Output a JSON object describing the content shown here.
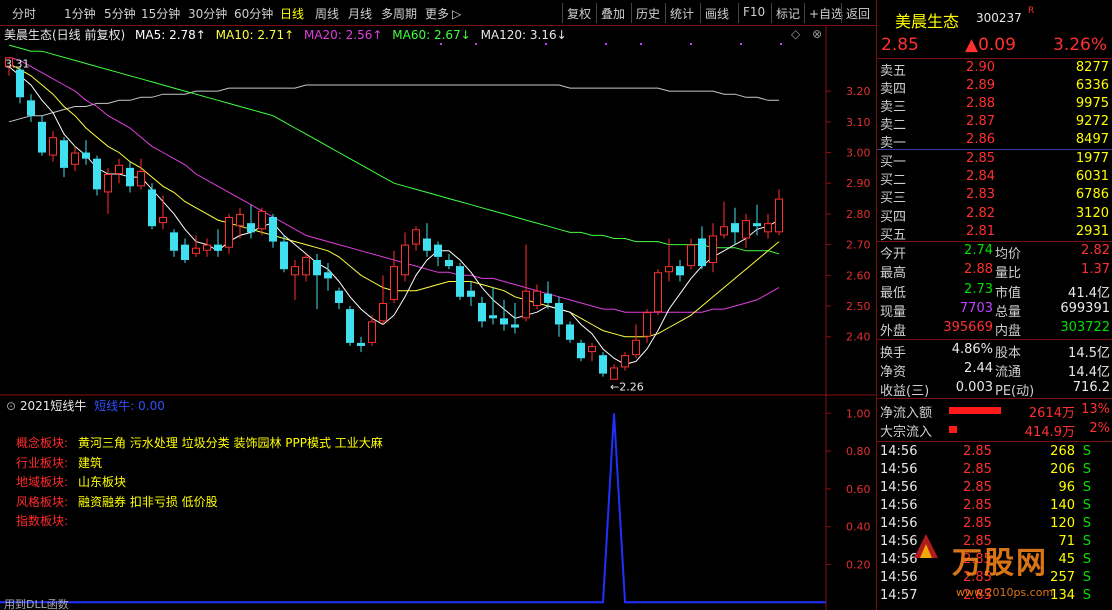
{
  "toolbar": {
    "periods": [
      "分时",
      "1分钟",
      "5分钟",
      "15分钟",
      "30分钟",
      "60分钟",
      "日线",
      "周线",
      "月线",
      "多周期",
      "更多"
    ],
    "active_period": "日线",
    "more_arrow": "▷",
    "actions": [
      "复权",
      "叠加",
      "历史",
      "统计",
      "画线",
      "F10",
      "标记",
      "+自选",
      "返回"
    ]
  },
  "chart": {
    "title": "美晨生态(日线 前复权)",
    "ma5": "MA5: 2.78↑",
    "ma10": "MA10: 2.71↑",
    "ma20": "MA20: 2.56↑",
    "ma60": "MA60: 2.67↓",
    "ma120": "MA120: 3.16↓",
    "high_label": "3.31",
    "low_label": "←2.26",
    "y_ticks": [
      "3.20",
      "3.10",
      "3.00",
      "2.90",
      "2.80",
      "2.70",
      "2.60",
      "2.50",
      "2.40"
    ],
    "colors": {
      "up": "#ff3030",
      "down": "#40e0f0",
      "ma5": "#ffffff",
      "ma10": "#ffff40",
      "ma20": "#e040e0",
      "ma60": "#40ff40",
      "ma120": "#c8c8c8"
    }
  },
  "chart_data": {
    "type": "candlestick",
    "title": "美晨生态(日线 前复权)",
    "y_ticks": [
      3.2,
      3.1,
      3.0,
      2.9,
      2.8,
      2.7,
      2.6,
      2.5,
      2.4
    ],
    "ylim": [
      2.22,
      3.36
    ],
    "candles": [
      {
        "o": 3.28,
        "c": 3.31,
        "h": 3.31,
        "l": 3.25
      },
      {
        "o": 3.27,
        "c": 3.18,
        "h": 3.28,
        "l": 3.16
      },
      {
        "o": 3.17,
        "c": 3.12,
        "h": 3.19,
        "l": 3.1
      },
      {
        "o": 3.1,
        "c": 3.0,
        "h": 3.12,
        "l": 2.99
      },
      {
        "o": 2.99,
        "c": 3.05,
        "h": 3.07,
        "l": 2.97
      },
      {
        "o": 3.04,
        "c": 2.95,
        "h": 3.05,
        "l": 2.92
      },
      {
        "o": 2.96,
        "c": 3.0,
        "h": 3.02,
        "l": 2.94
      },
      {
        "o": 3.0,
        "c": 2.98,
        "h": 3.04,
        "l": 2.96
      },
      {
        "o": 2.98,
        "c": 2.88,
        "h": 2.99,
        "l": 2.86
      },
      {
        "o": 2.87,
        "c": 2.93,
        "h": 2.95,
        "l": 2.8
      },
      {
        "o": 2.93,
        "c": 2.96,
        "h": 2.98,
        "l": 2.9
      },
      {
        "o": 2.95,
        "c": 2.89,
        "h": 2.97,
        "l": 2.87
      },
      {
        "o": 2.89,
        "c": 2.94,
        "h": 2.98,
        "l": 2.88
      },
      {
        "o": 2.88,
        "c": 2.76,
        "h": 2.9,
        "l": 2.75
      },
      {
        "o": 2.77,
        "c": 2.79,
        "h": 2.86,
        "l": 2.75
      },
      {
        "o": 2.74,
        "c": 2.68,
        "h": 2.75,
        "l": 2.66
      },
      {
        "o": 2.7,
        "c": 2.65,
        "h": 2.72,
        "l": 2.64
      },
      {
        "o": 2.67,
        "c": 2.69,
        "h": 2.73,
        "l": 2.66
      },
      {
        "o": 2.68,
        "c": 2.7,
        "h": 2.72,
        "l": 2.66
      },
      {
        "o": 2.7,
        "c": 2.68,
        "h": 2.75,
        "l": 2.66
      },
      {
        "o": 2.69,
        "c": 2.79,
        "h": 2.8,
        "l": 2.67
      },
      {
        "o": 2.76,
        "c": 2.8,
        "h": 2.82,
        "l": 2.72
      },
      {
        "o": 2.77,
        "c": 2.74,
        "h": 2.83,
        "l": 2.72
      },
      {
        "o": 2.75,
        "c": 2.81,
        "h": 2.82,
        "l": 2.73
      },
      {
        "o": 2.79,
        "c": 2.71,
        "h": 2.8,
        "l": 2.69
      },
      {
        "o": 2.71,
        "c": 2.62,
        "h": 2.73,
        "l": 2.61
      },
      {
        "o": 2.6,
        "c": 2.63,
        "h": 2.65,
        "l": 2.52
      },
      {
        "o": 2.6,
        "c": 2.66,
        "h": 2.67,
        "l": 2.58
      },
      {
        "o": 2.65,
        "c": 2.6,
        "h": 2.67,
        "l": 2.49
      },
      {
        "o": 2.61,
        "c": 2.59,
        "h": 2.64,
        "l": 2.55
      },
      {
        "o": 2.55,
        "c": 2.51,
        "h": 2.56,
        "l": 2.49
      },
      {
        "o": 2.49,
        "c": 2.38,
        "h": 2.5,
        "l": 2.37
      },
      {
        "o": 2.38,
        "c": 2.37,
        "h": 2.4,
        "l": 2.35
      },
      {
        "o": 2.38,
        "c": 2.45,
        "h": 2.47,
        "l": 2.37
      },
      {
        "o": 2.45,
        "c": 2.51,
        "h": 2.6,
        "l": 2.44
      },
      {
        "o": 2.52,
        "c": 2.63,
        "h": 2.68,
        "l": 2.51
      },
      {
        "o": 2.6,
        "c": 2.7,
        "h": 2.74,
        "l": 2.58
      },
      {
        "o": 2.7,
        "c": 2.75,
        "h": 2.76,
        "l": 2.68
      },
      {
        "o": 2.72,
        "c": 2.68,
        "h": 2.77,
        "l": 2.66
      },
      {
        "o": 2.7,
        "c": 2.66,
        "h": 2.71,
        "l": 2.63
      },
      {
        "o": 2.65,
        "c": 2.63,
        "h": 2.67,
        "l": 2.62
      },
      {
        "o": 2.63,
        "c": 2.53,
        "h": 2.64,
        "l": 2.52
      },
      {
        "o": 2.55,
        "c": 2.53,
        "h": 2.58,
        "l": 2.5
      },
      {
        "o": 2.51,
        "c": 2.45,
        "h": 2.53,
        "l": 2.43
      },
      {
        "o": 2.47,
        "c": 2.46,
        "h": 2.56,
        "l": 2.44
      },
      {
        "o": 2.46,
        "c": 2.44,
        "h": 2.52,
        "l": 2.42
      },
      {
        "o": 2.44,
        "c": 2.43,
        "h": 2.51,
        "l": 2.41
      },
      {
        "o": 2.46,
        "c": 2.55,
        "h": 2.7,
        "l": 2.45
      },
      {
        "o": 2.5,
        "c": 2.55,
        "h": 2.57,
        "l": 2.49
      },
      {
        "o": 2.54,
        "c": 2.51,
        "h": 2.58,
        "l": 2.49
      },
      {
        "o": 2.51,
        "c": 2.44,
        "h": 2.53,
        "l": 2.4
      },
      {
        "o": 2.44,
        "c": 2.39,
        "h": 2.45,
        "l": 2.38
      },
      {
        "o": 2.38,
        "c": 2.33,
        "h": 2.39,
        "l": 2.32
      },
      {
        "o": 2.35,
        "c": 2.37,
        "h": 2.38,
        "l": 2.32
      },
      {
        "o": 2.34,
        "c": 2.28,
        "h": 2.35,
        "l": 2.27
      },
      {
        "o": 2.26,
        "c": 2.3,
        "h": 2.31,
        "l": 2.26
      },
      {
        "o": 2.3,
        "c": 2.34,
        "h": 2.35,
        "l": 2.29
      },
      {
        "o": 2.34,
        "c": 2.39,
        "h": 2.44,
        "l": 2.33
      },
      {
        "o": 2.4,
        "c": 2.48,
        "h": 2.49,
        "l": 2.38
      },
      {
        "o": 2.48,
        "c": 2.61,
        "h": 2.62,
        "l": 2.47
      },
      {
        "o": 2.61,
        "c": 2.63,
        "h": 2.72,
        "l": 2.58
      },
      {
        "o": 2.63,
        "c": 2.6,
        "h": 2.65,
        "l": 2.58
      },
      {
        "o": 2.63,
        "c": 2.7,
        "h": 2.72,
        "l": 2.62
      },
      {
        "o": 2.72,
        "c": 2.63,
        "h": 2.76,
        "l": 2.62
      },
      {
        "o": 2.64,
        "c": 2.73,
        "h": 2.77,
        "l": 2.61
      },
      {
        "o": 2.73,
        "c": 2.76,
        "h": 2.84,
        "l": 2.72
      },
      {
        "o": 2.77,
        "c": 2.74,
        "h": 2.82,
        "l": 2.7
      },
      {
        "o": 2.72,
        "c": 2.78,
        "h": 2.8,
        "l": 2.69
      },
      {
        "o": 2.77,
        "c": 2.76,
        "h": 2.83,
        "l": 2.73
      },
      {
        "o": 2.74,
        "c": 2.77,
        "h": 2.8,
        "l": 2.72
      },
      {
        "o": 2.74,
        "c": 2.85,
        "h": 2.88,
        "l": 2.73
      }
    ],
    "ma5": [
      3.28,
      3.25,
      3.22,
      3.17,
      3.13,
      3.06,
      3.02,
      2.99,
      2.95,
      2.93,
      2.93,
      2.92,
      2.92,
      2.88,
      2.84,
      2.8,
      2.75,
      2.71,
      2.7,
      2.68,
      2.71,
      2.73,
      2.74,
      2.76,
      2.77,
      2.73,
      2.7,
      2.67,
      2.64,
      2.62,
      2.58,
      2.53,
      2.49,
      2.46,
      2.44,
      2.47,
      2.53,
      2.6,
      2.65,
      2.68,
      2.68,
      2.65,
      2.61,
      2.56,
      2.52,
      2.49,
      2.46,
      2.47,
      2.48,
      2.5,
      2.49,
      2.48,
      2.44,
      2.41,
      2.36,
      2.33,
      2.31,
      2.32,
      2.36,
      2.42,
      2.49,
      2.54,
      2.59,
      2.63,
      2.66,
      2.68,
      2.7,
      2.72,
      2.75,
      2.76,
      2.78
    ],
    "ma10": [
      3.29,
      3.27,
      3.25,
      3.22,
      3.19,
      3.15,
      3.12,
      3.08,
      3.05,
      3.02,
      3.0,
      2.97,
      2.95,
      2.92,
      2.89,
      2.87,
      2.84,
      2.82,
      2.8,
      2.78,
      2.77,
      2.76,
      2.75,
      2.74,
      2.73,
      2.72,
      2.71,
      2.7,
      2.69,
      2.68,
      2.66,
      2.63,
      2.6,
      2.58,
      2.56,
      2.55,
      2.55,
      2.55,
      2.56,
      2.57,
      2.58,
      2.58,
      2.58,
      2.57,
      2.56,
      2.55,
      2.53,
      2.52,
      2.51,
      2.5,
      2.49,
      2.48,
      2.46,
      2.44,
      2.42,
      2.41,
      2.4,
      2.4,
      2.4,
      2.41,
      2.43,
      2.45,
      2.47,
      2.5,
      2.53,
      2.56,
      2.59,
      2.62,
      2.65,
      2.68,
      2.71
    ],
    "ma20": [
      3.31,
      3.3,
      3.28,
      3.26,
      3.24,
      3.22,
      3.2,
      3.17,
      3.15,
      3.12,
      3.1,
      3.08,
      3.05,
      3.02,
      3.0,
      2.98,
      2.96,
      2.93,
      2.91,
      2.89,
      2.87,
      2.85,
      2.83,
      2.81,
      2.79,
      2.77,
      2.75,
      2.73,
      2.72,
      2.71,
      2.7,
      2.69,
      2.68,
      2.67,
      2.66,
      2.65,
      2.64,
      2.63,
      2.62,
      2.61,
      2.61,
      2.6,
      2.6,
      2.59,
      2.59,
      2.58,
      2.57,
      2.56,
      2.55,
      2.54,
      2.53,
      2.52,
      2.51,
      2.5,
      2.49,
      2.49,
      2.48,
      2.48,
      2.48,
      2.48,
      2.48,
      2.48,
      2.48,
      2.48,
      2.49,
      2.49,
      2.5,
      2.51,
      2.52,
      2.54,
      2.56
    ],
    "ma60": [
      3.35,
      3.34,
      3.33,
      3.33,
      3.32,
      3.31,
      3.3,
      3.29,
      3.28,
      3.27,
      3.26,
      3.25,
      3.24,
      3.23,
      3.22,
      3.21,
      3.2,
      3.19,
      3.18,
      3.17,
      3.16,
      3.15,
      3.14,
      3.13,
      3.12,
      3.1,
      3.08,
      3.06,
      3.04,
      3.02,
      3.0,
      2.98,
      2.96,
      2.94,
      2.92,
      2.9,
      2.89,
      2.88,
      2.87,
      2.86,
      2.85,
      2.84,
      2.83,
      2.82,
      2.81,
      2.8,
      2.79,
      2.78,
      2.77,
      2.76,
      2.75,
      2.74,
      2.74,
      2.73,
      2.73,
      2.72,
      2.72,
      2.71,
      2.71,
      2.71,
      2.7,
      2.7,
      2.7,
      2.7,
      2.69,
      2.69,
      2.69,
      2.68,
      2.68,
      2.68,
      2.67
    ],
    "ma120": [
      3.1,
      3.11,
      3.12,
      3.12,
      3.13,
      3.14,
      3.15,
      3.15,
      3.16,
      3.16,
      3.17,
      3.17,
      3.18,
      3.18,
      3.19,
      3.19,
      3.19,
      3.2,
      3.2,
      3.2,
      3.21,
      3.21,
      3.21,
      3.21,
      3.21,
      3.21,
      3.21,
      3.22,
      3.22,
      3.22,
      3.22,
      3.22,
      3.22,
      3.22,
      3.22,
      3.22,
      3.22,
      3.22,
      3.22,
      3.22,
      3.22,
      3.22,
      3.22,
      3.22,
      3.22,
      3.22,
      3.22,
      3.22,
      3.22,
      3.22,
      3.22,
      3.21,
      3.21,
      3.21,
      3.21,
      3.21,
      3.21,
      3.21,
      3.21,
      3.21,
      3.2,
      3.2,
      3.2,
      3.2,
      3.2,
      3.19,
      3.19,
      3.18,
      3.18,
      3.17,
      3.17
    ],
    "sub": {
      "y_ticks": [
        1.0,
        0.8,
        0.6,
        0.4,
        0.2
      ],
      "ylim": [
        -0.02,
        1.06
      ],
      "spike_index": 55
    }
  },
  "sub_panel": {
    "title": "2021短线牛",
    "indicator": "短线牛: 0.00",
    "y_ticks": [
      "1.00",
      "0.80",
      "0.60",
      "0.40",
      "0.20"
    ],
    "footer": "用到DLL函数",
    "sectors": [
      {
        "label": "概念板块:",
        "value": "黄河三角 污水处理 垃圾分类 装饰园林 PPP模式 工业大麻"
      },
      {
        "label": "行业板块:",
        "value": "建筑"
      },
      {
        "label": "地域板块:",
        "value": "山东板块"
      },
      {
        "label": "风格板块:",
        "value": "融资融券 扣非亏损 低价股"
      },
      {
        "label": "指数板块:",
        "value": ""
      }
    ]
  },
  "quote": {
    "name": "美晨生态",
    "code": "300237",
    "flag": "R",
    "price": "2.85",
    "change": "▲0.09",
    "pct": "3.26%",
    "asks": [
      {
        "label": "卖五",
        "price": "2.90",
        "vol": "8277"
      },
      {
        "label": "卖四",
        "price": "2.89",
        "vol": "6336"
      },
      {
        "label": "卖三",
        "price": "2.88",
        "vol": "9975"
      },
      {
        "label": "卖二",
        "price": "2.87",
        "vol": "9272"
      },
      {
        "label": "卖一",
        "price": "2.86",
        "vol": "8497"
      }
    ],
    "bids": [
      {
        "label": "买一",
        "price": "2.85",
        "vol": "1977"
      },
      {
        "label": "买二",
        "price": "2.84",
        "vol": "6031"
      },
      {
        "label": "买三",
        "price": "2.83",
        "vol": "6786"
      },
      {
        "label": "买四",
        "price": "2.82",
        "vol": "3120"
      },
      {
        "label": "买五",
        "price": "2.81",
        "vol": "2931"
      }
    ],
    "stats": [
      {
        "l1": "今开",
        "v1": "2.74",
        "c1": "green",
        "l2": "均价",
        "v2": "2.82",
        "c2": "red"
      },
      {
        "l1": "最高",
        "v1": "2.88",
        "c1": "red",
        "l2": "量比",
        "v2": "1.37",
        "c2": "red"
      },
      {
        "l1": "最低",
        "v1": "2.73",
        "c1": "green",
        "l2": "市值",
        "v2": "41.4亿",
        "c2": "white"
      },
      {
        "l1": "现量",
        "v1": "7703",
        "c1": "purple",
        "l2": "总量",
        "v2": "699391",
        "c2": "white"
      },
      {
        "l1": "外盘",
        "v1": "395669",
        "c1": "red",
        "l2": "内盘",
        "v2": "303722",
        "c2": "green"
      }
    ],
    "fundamentals": [
      {
        "l1": "换手",
        "v1": "4.86%",
        "l2": "股本",
        "v2": "14.5亿"
      },
      {
        "l1": "净资",
        "v1": "2.44",
        "l2": "流通",
        "v2": "14.4亿"
      },
      {
        "l1": "收益(三)",
        "v1": "0.003",
        "l2": "PE(动)",
        "v2": "716.2"
      }
    ],
    "flows": [
      {
        "label": "净流入额",
        "value": "2614万",
        "pct": "13%",
        "level": 0.13
      },
      {
        "label": "大宗流入",
        "value": "414.9万",
        "pct": "2%",
        "level": 0.02
      }
    ],
    "ticks": [
      {
        "t": "14:56",
        "p": "2.85",
        "q": "268",
        "s": "S"
      },
      {
        "t": "14:56",
        "p": "2.85",
        "q": "206",
        "s": "S"
      },
      {
        "t": "14:56",
        "p": "2.85",
        "q": "96",
        "s": "S"
      },
      {
        "t": "14:56",
        "p": "2.85",
        "q": "140",
        "s": "S"
      },
      {
        "t": "14:56",
        "p": "2.85",
        "q": "120",
        "s": "S"
      },
      {
        "t": "14:56",
        "p": "2.85",
        "q": "71",
        "s": "S"
      },
      {
        "t": "14:56",
        "p": "2.85",
        "q": "45",
        "s": "S"
      },
      {
        "t": "14:56",
        "p": "2.85",
        "q": "257",
        "s": "S"
      },
      {
        "t": "14:57",
        "p": "2.85",
        "q": "134",
        "s": "S"
      }
    ]
  },
  "watermark": {
    "logo_text": "万股网",
    "url": "www.2010ps.com"
  }
}
